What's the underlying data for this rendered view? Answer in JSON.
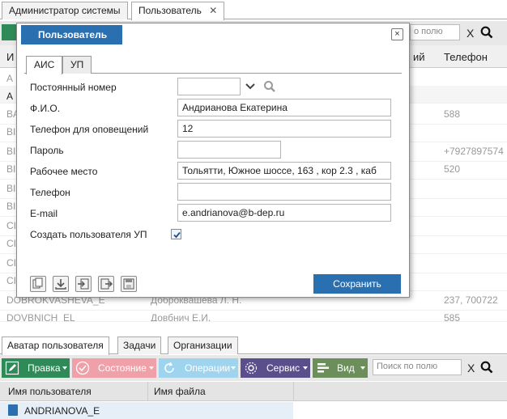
{
  "top_tabs": [
    {
      "label": "Администратор системы"
    },
    {
      "label": "Пользователь"
    }
  ],
  "top_toolbar": {
    "search_placeholder": "о полю",
    "clear": "X"
  },
  "bg_grid": {
    "columns": [
      "И",
      "ий",
      "Телефон"
    ],
    "rows": [
      {
        "c1": "А",
        "phone": ""
      },
      {
        "c1": "А",
        "phone": ""
      },
      {
        "c1": "BA",
        "phone": "588"
      },
      {
        "c1": "BI",
        "phone": ""
      },
      {
        "c1": "BI",
        "phone": "+7927897574"
      },
      {
        "c1": "BI",
        "phone": "520"
      },
      {
        "c1": "BI",
        "phone": ""
      },
      {
        "c1": "BI",
        "phone": ""
      },
      {
        "c1": "CI",
        "phone": ""
      },
      {
        "c1": "CI",
        "phone": ""
      },
      {
        "c1": "CI",
        "phone": ""
      },
      {
        "c1": "CI",
        "phone": ""
      },
      {
        "c1": "DOBROKVASHEVA_E",
        "c2": "Доброквашева Л. Н.",
        "phone": "237, 700722"
      },
      {
        "c1": "DOVBNICH_EL",
        "c2": "Довбнич Е.И.",
        "phone": "585"
      }
    ]
  },
  "modal": {
    "title": "Пользователь",
    "close": "×",
    "tabs": [
      {
        "label": "АИС"
      },
      {
        "label": "УП"
      }
    ],
    "fields": {
      "permanent_number": {
        "label": "Постоянный номер",
        "value": ""
      },
      "fio": {
        "label": "Ф.И.О.",
        "value": "Андрианова Екатерина"
      },
      "notify_phone": {
        "label": "Телефон для оповещений",
        "value": "12"
      },
      "password": {
        "label": "Пароль",
        "value": ""
      },
      "workplace": {
        "label": "Рабочее место",
        "value": "Тольятти, Южное шоссе, 163 , кор 2.3 , каб"
      },
      "phone": {
        "label": "Телефон",
        "value": ""
      },
      "email": {
        "label": "E-mail",
        "value": "e.andrianova@b-dep.ru"
      },
      "create_up": {
        "label": "Создать пользователя УП",
        "checked": true
      }
    },
    "save_label": "Сохранить"
  },
  "bottom_tabs": [
    {
      "label": "Аватар пользователя"
    },
    {
      "label": "Задачи"
    },
    {
      "label": "Организации"
    }
  ],
  "bottom_toolbar": {
    "buttons": [
      {
        "label": "Правка",
        "color": "#2e8b57"
      },
      {
        "label": "Состояние",
        "color": "#f0a0a8"
      },
      {
        "label": "Операции",
        "color": "#9fd4ef"
      },
      {
        "label": "Сервис",
        "color": "#5a4e8c"
      },
      {
        "label": "Вид",
        "color": "#6b8e5a"
      }
    ],
    "search_placeholder": "Поиск по полю",
    "clear": "X"
  },
  "bottom_grid": {
    "columns": [
      "Имя пользователя",
      "Имя файла"
    ],
    "rows": [
      {
        "user": "ANDRIANOVA_E",
        "file": ""
      }
    ]
  }
}
